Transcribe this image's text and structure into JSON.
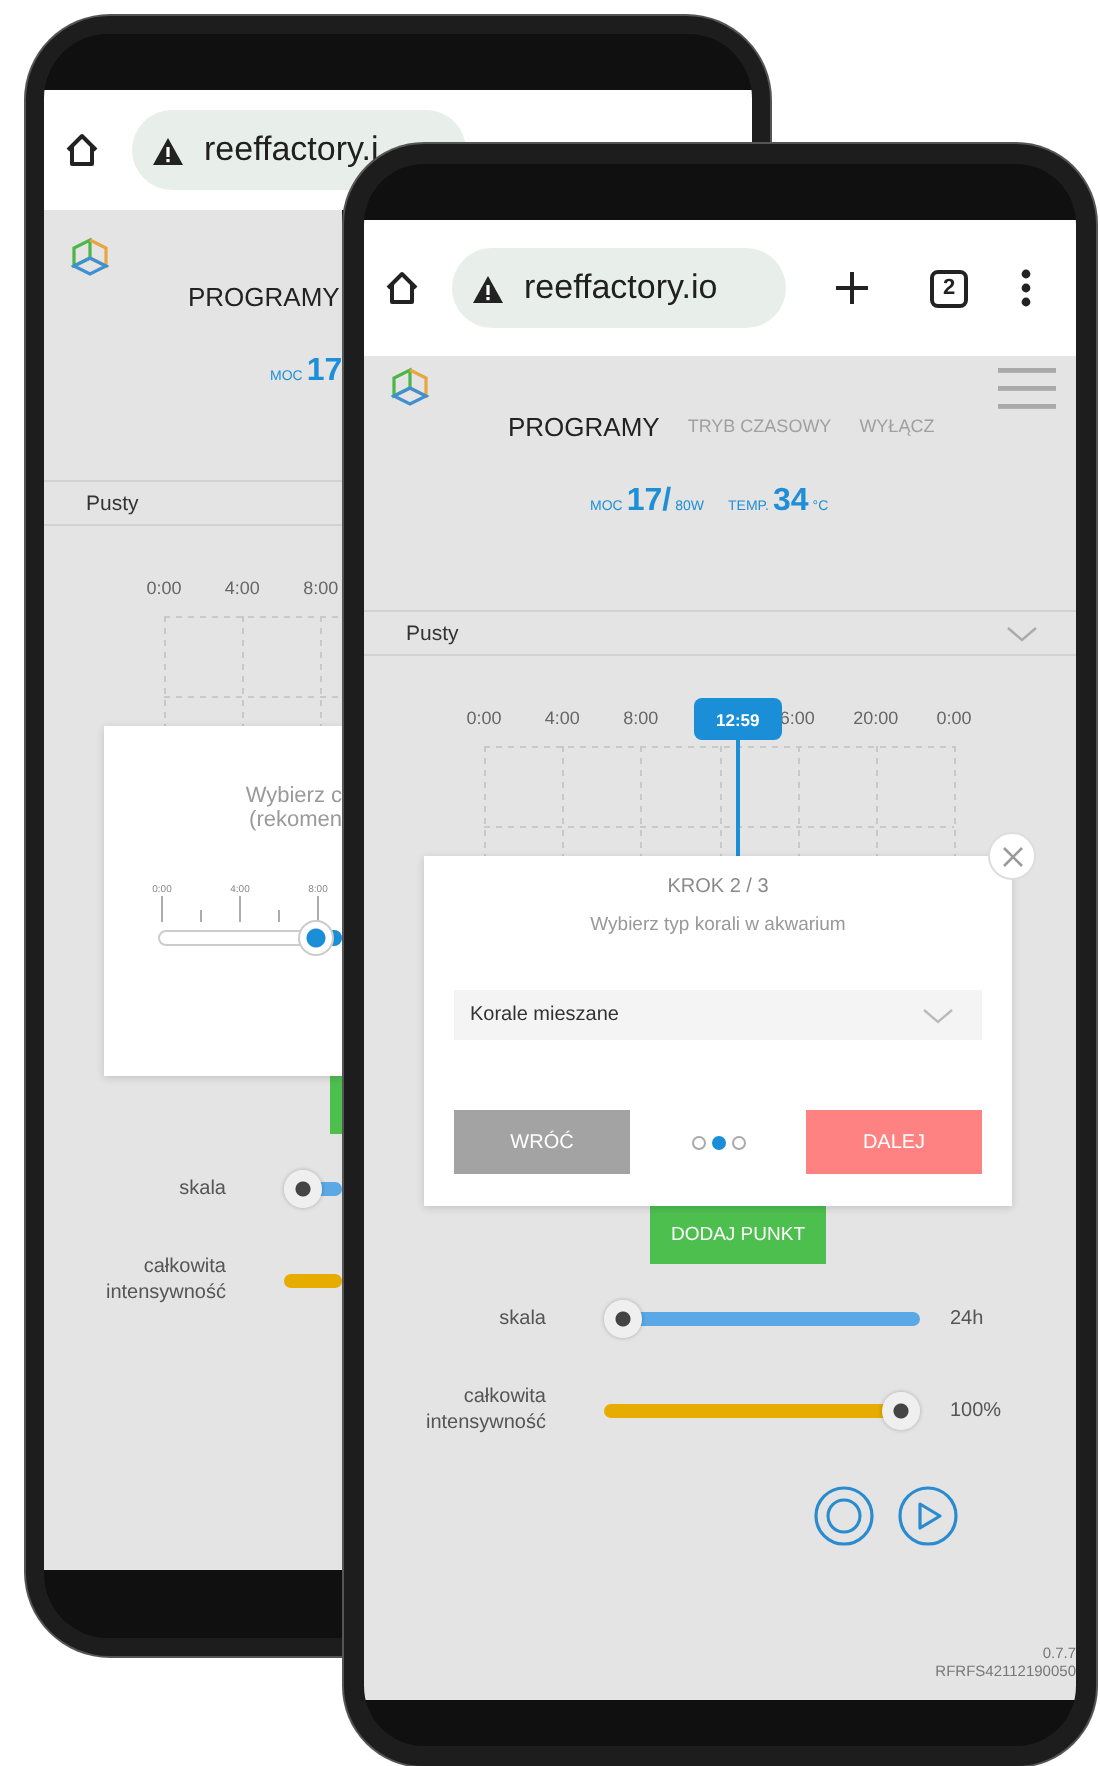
{
  "back_phone": {
    "browser": {
      "url": "reeffactory.i"
    },
    "nav": [
      {
        "label": "PROGRAMY",
        "selected": true
      }
    ],
    "stats": {
      "power_label": "MOC",
      "power_value": "17"
    },
    "program": "Pusty",
    "timeline": {
      "labels": [
        "0:00",
        "4:00",
        "8:00"
      ]
    },
    "dialog": {
      "kind": "time",
      "lines": [
        "Wybierz c",
        "(rekomen"
      ],
      "ticks": [
        "0:00",
        "4:00",
        "8:00"
      ],
      "level": 0.95
    },
    "sliders": [
      {
        "label": "skala",
        "kind": "tail",
        "color": "#5aa9e6",
        "level": 0
      },
      {
        "label": "całkowita intensywność",
        "kind": "fill",
        "color": "#e6ac00"
      }
    ]
  },
  "front_phone": {
    "browser": {
      "url": "reeffactory.io",
      "tab_count": "2"
    },
    "nav": [
      {
        "label": "PROGRAMY",
        "selected": true
      },
      {
        "label": "TRYB CZASOWY",
        "selected": false
      },
      {
        "label": "WYŁĄCZ",
        "selected": false
      }
    ],
    "stats": {
      "power_label": "MOC",
      "power_value": "17/",
      "power_max": "80W",
      "temp_label": "TEMP.",
      "temp_value": "34",
      "temp_unit": "°C"
    },
    "program": "Pusty",
    "timeline": {
      "labels": [
        "0:00",
        "4:00",
        "8:00",
        "6:00",
        "20:00",
        "0:00"
      ],
      "marker": {
        "label": "12:59",
        "level": 0.54
      }
    },
    "dialog": {
      "kind": "select",
      "closable": true,
      "step": "KROK 2 / 3",
      "prompt": "Wybierz typ korali w akwarium",
      "value": "Korale mieszane",
      "back": "WRÓĆ",
      "next": "DALEJ",
      "pager": [
        {
          "selected": false
        },
        {
          "selected": true
        },
        {
          "selected": false
        }
      ]
    },
    "add_button": "DODAJ PUNKT",
    "sliders": [
      {
        "label": "skala",
        "kind": "tail",
        "color": "#5aa9e6",
        "level": 0,
        "reading": "24h"
      },
      {
        "label": "całkowita intensywność",
        "kind": "fill",
        "color": "#e6ac00",
        "level": 1,
        "reading": "100%"
      }
    ],
    "version": "0.7.7",
    "serial": "RFRFS42112190050"
  }
}
